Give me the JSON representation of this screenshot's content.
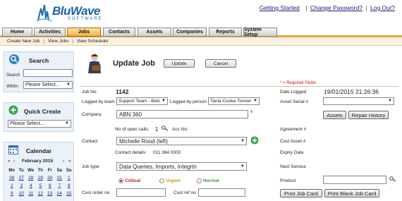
{
  "brand": {
    "name": "BluWave",
    "tagline": "SOFTWARE"
  },
  "top_links": {
    "getting_started": "Getting Started",
    "change_password": "Change Password?",
    "logout": "Log Out?",
    "sep": "|"
  },
  "nav": {
    "tabs": [
      {
        "label": "Home"
      },
      {
        "label": "Activities"
      },
      {
        "label": "Jobs"
      },
      {
        "label": "Contacts"
      },
      {
        "label": "Assets"
      },
      {
        "label": "Companies"
      },
      {
        "label": "Reports"
      },
      {
        "label": "System Setup"
      }
    ]
  },
  "subnav": {
    "create": "Create New Job",
    "view": "View Jobs",
    "scheduler": "View Scheduler"
  },
  "sidebar": {
    "search_title": "Search",
    "search_label": "Search",
    "within_label": "Within",
    "within_value": "Please Select...",
    "quick_create_title": "Quick Create",
    "quick_create_value": "Please Select...",
    "calendar_title": "Calendar",
    "calendar_prev_year": "«",
    "calendar_prev_month": "‹",
    "calendar_month": "February 2015",
    "calendar_next_month": "›",
    "calendar_next_year": "»",
    "weekdays": [
      "Mo",
      "Tu",
      "We",
      "Th",
      "Fr",
      "Sa",
      "Su"
    ],
    "week1": [
      "26",
      "27",
      "28",
      "29",
      "30",
      "31",
      "1"
    ],
    "week2": [
      "2",
      "3",
      "4",
      "5",
      "6",
      "7",
      "8"
    ],
    "week3": [
      "9",
      "10",
      "11",
      "12",
      "13",
      "14",
      "15"
    ]
  },
  "main": {
    "title": "Update Job",
    "update_button": "Update",
    "cancel_button": "Cancel",
    "required_note": "* = Required Fields",
    "job_no_label": "Job No",
    "job_no_value": "1142",
    "logged_by_team_label": "Logged by team",
    "logged_by_team_value": "Support Team - Betc",
    "logged_by_person_label": "Logged by person",
    "logged_by_person_value": "Tania Cooke-Tonner",
    "company_label": "Company",
    "company_value": "ABN 360",
    "required_star": "*",
    "open_calls_label": "No of open calls:",
    "open_calls_value": "1",
    "acc_no_label": "Acc No:",
    "contact_label": "Contact",
    "contact_value": "Michelle Rood (left)",
    "contact_details_label": "Contact details:",
    "contact_details_value": "011 384 0300",
    "job_type_label": "Job type",
    "job_type_value": "Data Queries, Imports, Integrtn",
    "priority_critical": "Critical",
    "priority_urgent": "Urgent",
    "priority_normal": "Normal",
    "cust_order_label": "Cust order no",
    "cust_ref_label": "Cust ref no",
    "date_logged_label": "Date Logged",
    "date_logged_value": "19/01/2015 21:26:36",
    "asset_serial_label": "Asset Serial #",
    "assets_button": "Assets",
    "repair_history_button": "Repair History",
    "agreement_label": "Agreement #",
    "cust_asset_label": "Cust Asset #",
    "expiry_label": "Expiry Date",
    "next_service_label": "Next Service",
    "product_label": "Product",
    "print_job_card": "Print Job Card",
    "print_blank_job_card": "Print Blank Job Card"
  },
  "colors": {
    "accent": "#e8a64a",
    "panel": "#eaf1f8",
    "critical": "#c0141c",
    "urgent": "#c8a000",
    "normal": "#3a9a3a"
  }
}
